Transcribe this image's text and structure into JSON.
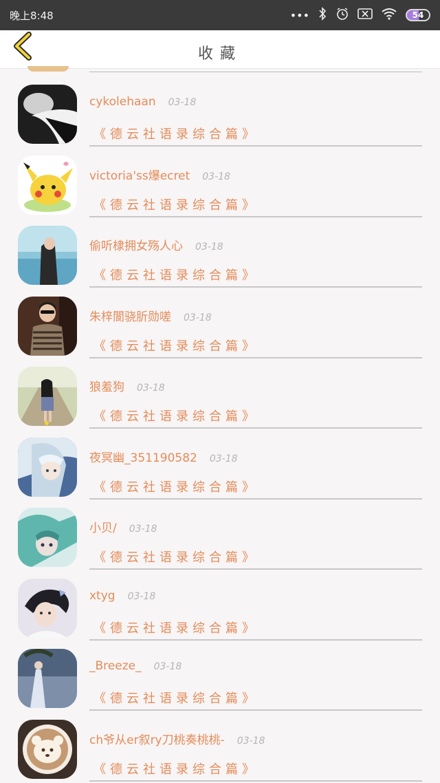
{
  "status_bar": {
    "time": "晚上8:48",
    "dots": "•••",
    "battery": "54"
  },
  "header": {
    "title": "收藏",
    "back_icon": "chevron-left-icon"
  },
  "items": [
    {
      "name": "cykolehaan",
      "date": "03-18",
      "title": "《德云社语录综合篇》",
      "avatar": "monochrome-man-portrait"
    },
    {
      "name": "victoria'ss爆ecret",
      "date": "03-18",
      "title": "《德云社语录综合篇》",
      "avatar": "pikachu"
    },
    {
      "name": "偷听棣拥女殇人心",
      "date": "03-18",
      "title": "《德云社语录综合篇》",
      "avatar": "girl-by-sea"
    },
    {
      "name": "朱梓閬骁肵勋嗟",
      "date": "03-18",
      "title": "《德云社语录综合篇》",
      "avatar": "boy-sunglasses"
    },
    {
      "name": "狼羞狗",
      "date": "03-18",
      "title": "《德云社语录综合篇》",
      "avatar": "girl-on-path"
    },
    {
      "name": "夜冥幽_351190582",
      "date": "03-18",
      "title": "《德云社语录综合篇》",
      "avatar": "anime-white-hair"
    },
    {
      "name": "小贝/",
      "date": "03-18",
      "title": "《德云社语录综合篇》",
      "avatar": "anime-teal-hair"
    },
    {
      "name": "xtyg",
      "date": "03-18",
      "title": "《德云社语录综合篇》",
      "avatar": "boy-portrait"
    },
    {
      "name": "_Breeze_",
      "date": "03-18",
      "title": "《德云社语录综合篇》",
      "avatar": "anime-moon-scene"
    },
    {
      "name": "ch爷从er叙ry刀桃奏桃桃-",
      "date": "03-18",
      "title": "《德云社语录综合篇》",
      "avatar": "latte-bear"
    }
  ]
}
